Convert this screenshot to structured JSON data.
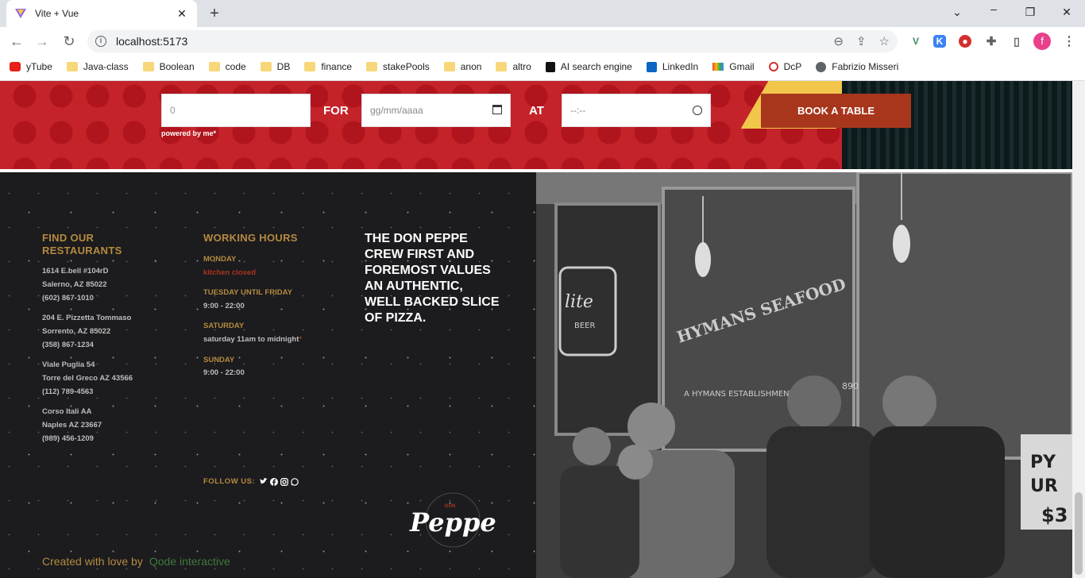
{
  "browser": {
    "tab_title": "Vite + Vue",
    "url": "localhost:5173",
    "profile_initial": "f",
    "bookmarks": [
      "yTube",
      "Java-class",
      "Boolean",
      "code",
      "DB",
      "finance",
      "stakePools",
      "anon",
      "altro",
      "AI search engine",
      "LinkedIn",
      "Gmail",
      "DcP",
      "Fabrizio Misseri"
    ]
  },
  "booking": {
    "people_value": "0",
    "for_label": "FOR",
    "date_placeholder": "gg/mm/aaaa",
    "at_label": "AT",
    "time_placeholder": "--:--",
    "powered_by": "powered by me*",
    "book_button": "BOOK A TABLE"
  },
  "footer": {
    "restaurants_title": "FIND OUR RESTAURANTS",
    "restaurants": [
      {
        "line1": "1614 E.bell #104rD",
        "line2": "Salerno, AZ 85022",
        "phone": "(602) 867-1010"
      },
      {
        "line1": "204 E. Pizzetta Tommaso",
        "line2": "Sorrento, AZ 85022",
        "phone": "(358) 867-1234"
      },
      {
        "line1": "Viale Puglia 54",
        "line2": "Torre del Greco AZ 43566",
        "phone": "(112) 789-4563"
      },
      {
        "line1": "Corso Itali AA",
        "line2": "Naples AZ 23667",
        "phone": "(989) 456-1209"
      }
    ],
    "hours_title": "WORKING HOURS",
    "hours": [
      {
        "day": "MONDAY",
        "time": "kitchen closed"
      },
      {
        "day": "TUESDAY UNTIL FRIDAY",
        "time": "9:00 - 22:00"
      },
      {
        "day": "SATURDAY",
        "time": "saturday 11am to midnight",
        "note": "*"
      },
      {
        "day": "SUNDAY",
        "time": "9:00 - 22:00"
      }
    ],
    "follow_label": "FOLLOW US:",
    "social_icons": [
      "twitter-icon",
      "facebook-icon",
      "instagram-icon",
      "whatsapp-icon"
    ],
    "tagline": "THE DON PEPPE CREW FIRST AND FOREMOST VALUES AN AUTHENTIC, WELL BACKED SLICE OF PIZZA.",
    "logo_text": "Peppe",
    "created_by": "Created with love by",
    "credit": "Qode interactive"
  },
  "colors": {
    "accent_gold": "#b48b3f",
    "accent_red": "#a8361c",
    "footer_bg": "#1c1b1e"
  }
}
